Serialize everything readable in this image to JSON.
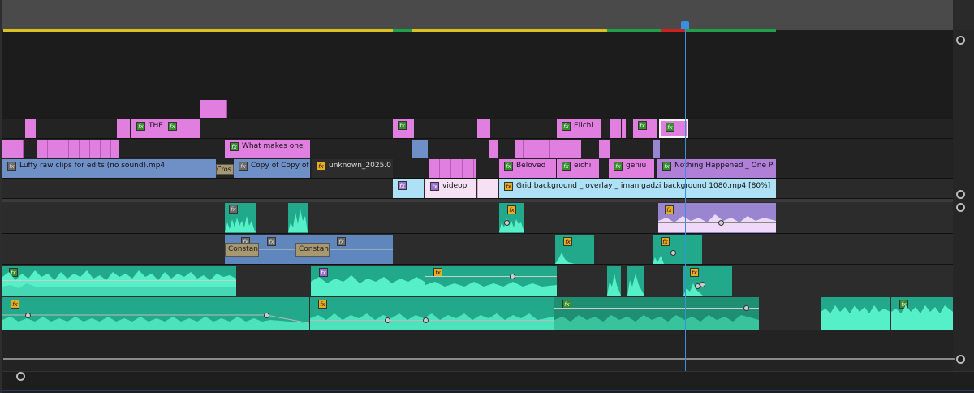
{
  "tracks": {
    "v4": [
      {
        "label": "THE"
      }
    ],
    "v5": [
      {
        "label": "Eiichi"
      }
    ],
    "v3": [
      {
        "label": "What makes one"
      }
    ],
    "v2": [
      {
        "label": "Luffy raw clips for edits (no sound).mp4"
      },
      {
        "label": "Cros"
      },
      {
        "label": "Copy of Copy of"
      },
      {
        "label": "unknown_2025.0"
      },
      {
        "label": "Beloved"
      },
      {
        "label": "eichi"
      },
      {
        "label": "geniu"
      },
      {
        "label": "Nothing Happened _ One Pi"
      }
    ],
    "v1": [
      {
        "label": "videopl"
      },
      {
        "label": "Grid background _ overlay _ iman gadzi background 1080.mp4 [80%]"
      }
    ],
    "a2": [
      {
        "label": "Constant"
      },
      {
        "label": "Constant"
      }
    ]
  },
  "colors": {
    "pink": "#e07fe0",
    "blue": "#6f90c6",
    "lightblue": "#aee0f6",
    "teal": "#22a88a",
    "wave": "#56f0c8",
    "playhead": "#3b8fe0",
    "lavender": "#9a85d0"
  }
}
